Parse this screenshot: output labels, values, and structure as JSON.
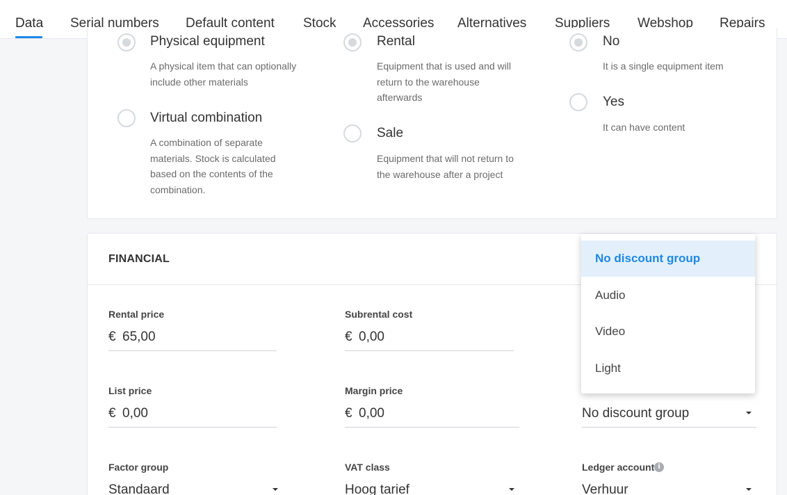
{
  "tabs": [
    {
      "label": "Data",
      "active": true
    },
    {
      "label": "Serial numbers"
    },
    {
      "label": "Default content"
    },
    {
      "label": "Stock"
    },
    {
      "label": "Accessories"
    },
    {
      "label": "Alternatives"
    },
    {
      "label": "Suppliers"
    },
    {
      "label": "Webshop"
    },
    {
      "label": "Repairs"
    }
  ],
  "type_options": {
    "physical": {
      "title": "Physical equipment",
      "desc": "A physical item that can optionally include other materials",
      "checked": true
    },
    "virtual": {
      "title": "Virtual combination",
      "desc": "A combination of separate materials. Stock is calculated based on the contents of the combination.",
      "checked": false
    },
    "rental": {
      "title": "Rental",
      "desc": "Equipment that is used and will return to the warehouse afterwards",
      "checked": true
    },
    "sale": {
      "title": "Sale",
      "desc": "Equipment that will not return to the warehouse after a project",
      "checked": false
    },
    "no": {
      "title": "No",
      "desc": "It is a single equipment item",
      "checked": true
    },
    "yes": {
      "title": "Yes",
      "desc": "It can have content",
      "checked": false
    }
  },
  "financial": {
    "title": "FINANCIAL",
    "rental_price": {
      "label": "Rental price",
      "currency": "€",
      "value": "65,00"
    },
    "subrental_cost": {
      "label": "Subrental cost",
      "currency": "€",
      "value": "0,00"
    },
    "list_price": {
      "label": "List price",
      "currency": "€",
      "value": "0,00"
    },
    "margin_price": {
      "label": "Margin price",
      "currency": "€",
      "value": "0,00"
    },
    "discount_group": {
      "value": "No discount group"
    },
    "factor_group": {
      "label": "Factor group",
      "value": "Standaard"
    },
    "vat_class": {
      "label": "VAT class",
      "value": "Hoog tarief"
    },
    "ledger_account": {
      "label": "Ledger account",
      "value": "Verhuur",
      "info_icon": "i"
    }
  },
  "discount_dropdown": {
    "options": [
      "No discount group",
      "Audio",
      "Video",
      "Light"
    ],
    "selected_index": 0
  },
  "colors": {
    "accent": "#1e88e5",
    "selected_bg": "#e3f0fb"
  }
}
